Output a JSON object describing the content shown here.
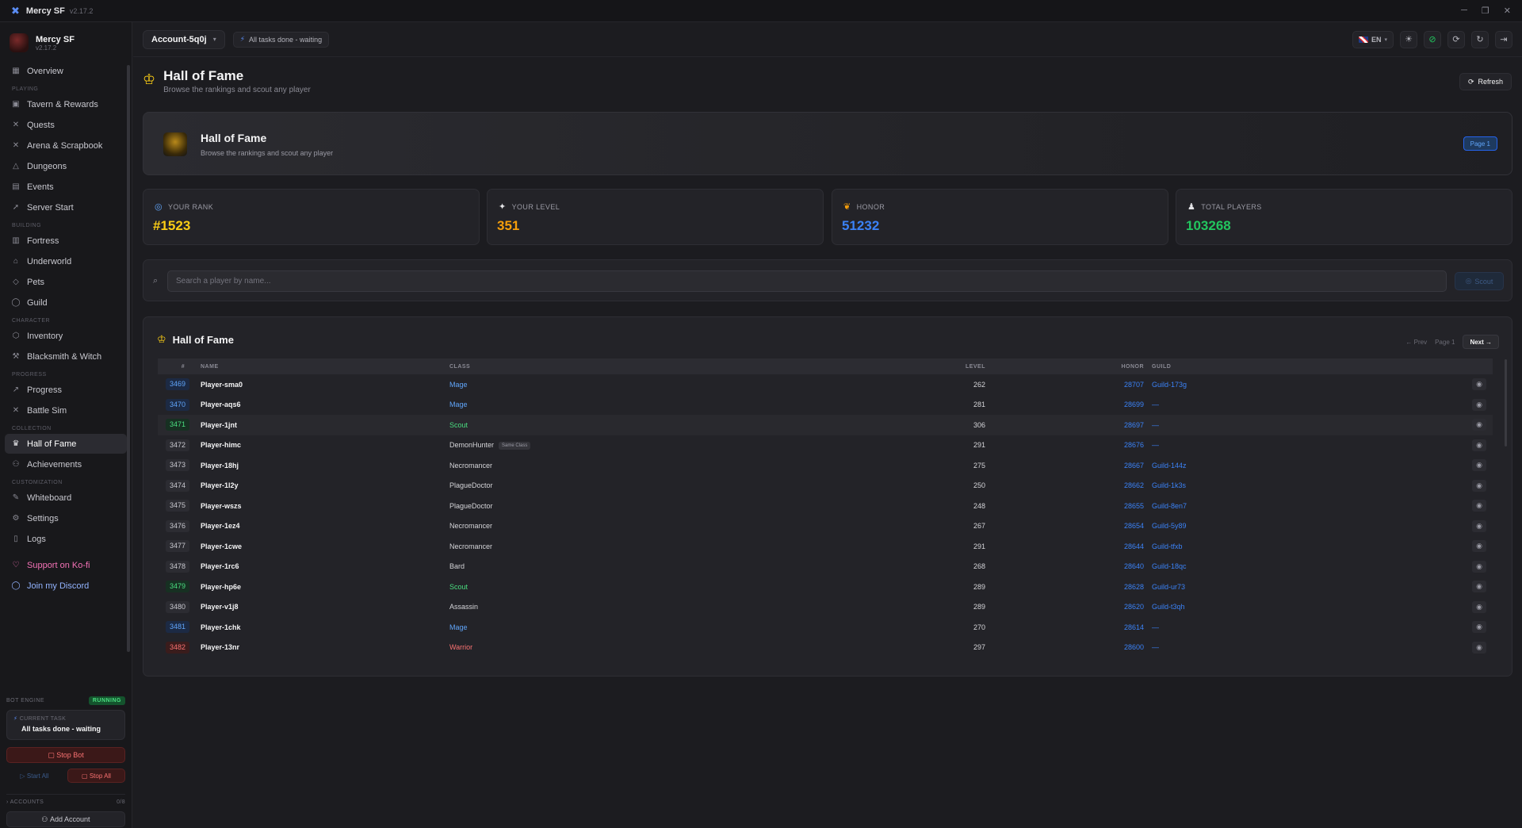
{
  "window": {
    "title": "Mercy SF",
    "version": "v2.17.2",
    "controls": [
      "─",
      "❐",
      "✕"
    ]
  },
  "sidebar": {
    "profile_name": "Mercy SF",
    "profile_version": "v2.17.2",
    "items": {
      "overview": "Overview",
      "tavern": "Tavern & Rewards",
      "quests": "Quests",
      "arena": "Arena & Scrapbook",
      "dungeons": "Dungeons",
      "events": "Events",
      "server_start": "Server Start",
      "fortress": "Fortress",
      "underworld": "Underworld",
      "pets": "Pets",
      "guild": "Guild",
      "inventory": "Inventory",
      "blacksmith": "Blacksmith & Witch",
      "progress": "Progress",
      "battle_sim": "Battle Sim",
      "hall_of_fame": "Hall of Fame",
      "achievements": "Achievements",
      "whiteboard": "Whiteboard",
      "settings": "Settings",
      "logs": "Logs",
      "kofi": "Support on Ko-fi",
      "discord": "Join my Discord"
    },
    "sections": {
      "playing": "PLAYING",
      "building": "BUILDING",
      "character": "CHARACTER",
      "progress": "PROGRESS",
      "collection": "COLLECTION",
      "customization": "CUSTOMIZATION"
    },
    "engine": {
      "label": "BOT ENGINE",
      "status": "RUNNING",
      "task_label": "CURRENT TASK",
      "task_value": "All tasks done - waiting",
      "stop_bot": "Stop Bot",
      "start_all": "Start All",
      "stop_all": "Stop All",
      "accounts_label": "ACCOUNTS",
      "accounts_count": "0/8",
      "add_account": "Add Account"
    }
  },
  "topbar": {
    "account": "Account-5q0j",
    "status": "All tasks done - waiting",
    "language": "EN"
  },
  "page": {
    "title": "Hall of Fame",
    "subtitle": "Browse the rankings and scout any player",
    "refresh_label": "Refresh"
  },
  "hero": {
    "title": "Hall of Fame",
    "subtitle": "Browse the rankings and scout any player",
    "badge": "Page 1"
  },
  "stats": {
    "rank": {
      "label": "YOUR RANK",
      "value": "#1523",
      "color": "#facc15"
    },
    "level": {
      "label": "YOUR LEVEL",
      "value": "351",
      "color": "#f59e0b"
    },
    "honor": {
      "label": "HONOR",
      "value": "51232",
      "color": "#3b82f6"
    },
    "players": {
      "label": "TOTAL PLAYERS",
      "value": "103268",
      "color": "#22c55e"
    }
  },
  "search": {
    "placeholder": "Search a player by name...",
    "button": "Scout"
  },
  "table": {
    "title": "Hall of Fame",
    "prev": "← Prev",
    "page": "Page 1",
    "next": "Next →",
    "headers": {
      "rank": "#",
      "name": "NAME",
      "class": "CLASS",
      "level": "LEVEL",
      "honor": "HONOR",
      "guild": "GUILD"
    },
    "same_class_tag": "Same Class",
    "rows": [
      {
        "rank": "3469",
        "name": "Player-sma0",
        "class": "Mage",
        "level": "262",
        "honor": "28707",
        "guild": "Guild-173g"
      },
      {
        "rank": "3470",
        "name": "Player-aqs6",
        "class": "Mage",
        "level": "281",
        "honor": "28699",
        "guild": "—"
      },
      {
        "rank": "3471",
        "name": "Player-1jnt",
        "class": "Scout",
        "level": "306",
        "honor": "28697",
        "guild": "—"
      },
      {
        "rank": "3472",
        "name": "Player-himc",
        "class": "DemonHunter",
        "level": "291",
        "honor": "28676",
        "guild": "—"
      },
      {
        "rank": "3473",
        "name": "Player-18hj",
        "class": "Necromancer",
        "level": "275",
        "honor": "28667",
        "guild": "Guild-144z"
      },
      {
        "rank": "3474",
        "name": "Player-1l2y",
        "class": "PlagueDoctor",
        "level": "250",
        "honor": "28662",
        "guild": "Guild-1k3s"
      },
      {
        "rank": "3475",
        "name": "Player-wszs",
        "class": "PlagueDoctor",
        "level": "248",
        "honor": "28655",
        "guild": "Guild-8en7"
      },
      {
        "rank": "3476",
        "name": "Player-1ez4",
        "class": "Necromancer",
        "level": "267",
        "honor": "28654",
        "guild": "Guild-5y89"
      },
      {
        "rank": "3477",
        "name": "Player-1cwe",
        "class": "Necromancer",
        "level": "291",
        "honor": "28644",
        "guild": "Guild-tfxb"
      },
      {
        "rank": "3478",
        "name": "Player-1rc6",
        "class": "Bard",
        "level": "268",
        "honor": "28640",
        "guild": "Guild-18qc"
      },
      {
        "rank": "3479",
        "name": "Player-hp6e",
        "class": "Scout",
        "level": "289",
        "honor": "28628",
        "guild": "Guild-ur73"
      },
      {
        "rank": "3480",
        "name": "Player-v1j8",
        "class": "Assassin",
        "level": "289",
        "honor": "28620",
        "guild": "Guild-t3qh"
      },
      {
        "rank": "3481",
        "name": "Player-1chk",
        "class": "Mage",
        "level": "270",
        "honor": "28614",
        "guild": "—"
      },
      {
        "rank": "3482",
        "name": "Player-13nr",
        "class": "Warrior",
        "level": "297",
        "honor": "28600",
        "guild": "—"
      }
    ]
  }
}
